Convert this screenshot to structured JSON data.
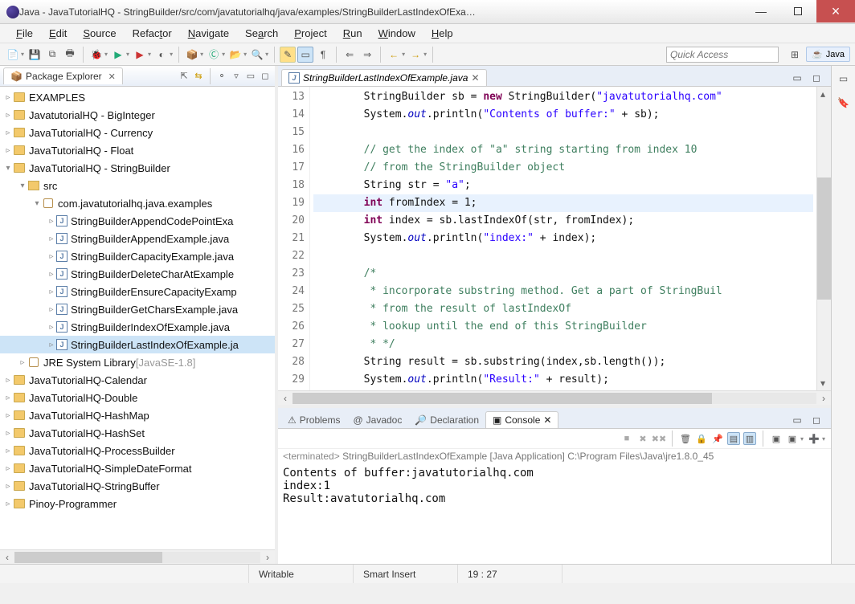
{
  "window": {
    "title": "Java - JavaTutorialHQ - StringBuilder/src/com/javatutorialhq/java/examples/StringBuilderLastIndexOfExa…"
  },
  "menu": {
    "file": "File",
    "edit": "Edit",
    "source": "Source",
    "refactor": "Refactor",
    "navigate": "Navigate",
    "search": "Search",
    "project": "Project",
    "run": "Run",
    "window": "Window",
    "help": "Help"
  },
  "quick_access_placeholder": "Quick Access",
  "perspective": {
    "java": "Java"
  },
  "package_explorer": {
    "title": "Package Explorer",
    "projects": [
      {
        "name": "EXAMPLES",
        "expanded": false
      },
      {
        "name": "JavatutorialHQ - BigInteger",
        "expanded": false
      },
      {
        "name": "JavaTutorialHQ - Currency",
        "expanded": false
      },
      {
        "name": "JavaTutorialHQ - Float",
        "expanded": false
      },
      {
        "name": "JavaTutorialHQ - StringBuilder",
        "expanded": true,
        "src": {
          "name": "src",
          "expanded": true,
          "pkg": {
            "name": "com.javatutorialhq.java.examples",
            "expanded": true,
            "files": [
              "StringBuilderAppendCodePointExa",
              "StringBuilderAppendExample.java",
              "StringBuilderCapacityExample.java",
              "StringBuilderDeleteCharAtExample",
              "StringBuilderEnsureCapacityExamp",
              "StringBuilderGetCharsExample.java",
              "StringBuilderIndexOfExample.java",
              "StringBuilderLastIndexOfExample.ja"
            ],
            "selected_index": 7
          }
        },
        "jre": {
          "label": "JRE System Library",
          "qualifier": "[JavaSE-1.8]"
        }
      },
      {
        "name": "JavaTutorialHQ-Calendar",
        "expanded": false
      },
      {
        "name": "JavaTutorialHQ-Double",
        "expanded": false
      },
      {
        "name": "JavaTutorialHQ-HashMap",
        "expanded": false
      },
      {
        "name": "JavaTutorialHQ-HashSet",
        "expanded": false
      },
      {
        "name": "JavaTutorialHQ-ProcessBuilder",
        "expanded": false
      },
      {
        "name": "JavaTutorialHQ-SimpleDateFormat",
        "expanded": false
      },
      {
        "name": "JavaTutorialHQ-StringBuffer",
        "expanded": false
      },
      {
        "name": "Pinoy-Programmer",
        "expanded": false
      }
    ]
  },
  "editor": {
    "tab": "StringBuilderLastIndexOfExample.java",
    "first_line": 13,
    "highlight_line": 19,
    "lines": [
      {
        "t": "code",
        "raw": "        StringBuilder sb = new StringBuilder(\"javatutorialhq.com\""
      },
      {
        "t": "code",
        "raw": "        System.out.println(\"Contents of buffer:\" + sb);"
      },
      {
        "t": "blank",
        "raw": ""
      },
      {
        "t": "cmt",
        "raw": "        // get the index of \"a\" string starting from index 10"
      },
      {
        "t": "cmt",
        "raw": "        // from the StringBuilder object"
      },
      {
        "t": "code",
        "raw": "        String str = \"a\";"
      },
      {
        "t": "code",
        "raw": "        int fromIndex = 1;"
      },
      {
        "t": "code",
        "raw": "        int index = sb.lastIndexOf(str, fromIndex);"
      },
      {
        "t": "code",
        "raw": "        System.out.println(\"index:\" + index);"
      },
      {
        "t": "blank",
        "raw": ""
      },
      {
        "t": "cmt",
        "raw": "        /*"
      },
      {
        "t": "cmt",
        "raw": "         * incorporate substring method. Get a part of StringBuil"
      },
      {
        "t": "cmt",
        "raw": "         * from the result of lastIndexOf"
      },
      {
        "t": "cmt",
        "raw": "         * lookup until the end of this StringBuilder"
      },
      {
        "t": "cmt",
        "raw": "         * */"
      },
      {
        "t": "code",
        "raw": "        String result = sb.substring(index,sb.length());"
      },
      {
        "t": "code",
        "raw": "        System.out.println(\"Result:\" + result);"
      }
    ]
  },
  "bottom_views": {
    "problems": "Problems",
    "javadoc": "Javadoc",
    "declaration": "Declaration",
    "console": "Console"
  },
  "console": {
    "header_prefix": "<terminated>",
    "header_main": "StringBuilderLastIndexOfExample [Java Application] C:\\Program Files\\Java\\jre1.8.0_45",
    "lines": [
      "Contents of buffer:javatutorialhq.com",
      "index:1",
      "Result:avatutorialhq.com"
    ]
  },
  "status": {
    "writable": "Writable",
    "insert": "Smart Insert",
    "pos": "19 : 27"
  }
}
